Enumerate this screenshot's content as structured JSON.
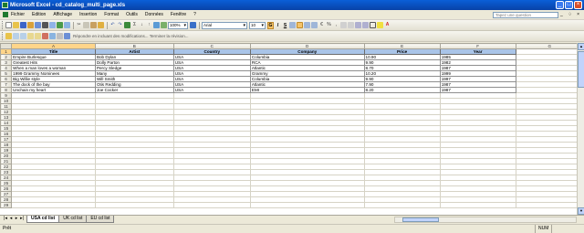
{
  "window": {
    "title": "Microsoft Excel - cd_catalog_multi_page.xls",
    "controls": [
      "_",
      "□",
      "×"
    ]
  },
  "menu": {
    "items": [
      "Fichier",
      "Edition",
      "Affichage",
      "Insertion",
      "Format",
      "Outils",
      "Données",
      "Fenêtre",
      "?"
    ],
    "help_placeholder": "Tapez une question",
    "doc_controls": "_ ♢ ×"
  },
  "toolbar": {
    "zoom": "100%",
    "font_name": "Arial",
    "font_size": "10",
    "bold": "G",
    "italic": "I",
    "underline": "S",
    "review_text": "Répondre en incluant des modifications... Terminer la révision..."
  },
  "formula_bar": {
    "name_box": "",
    "fx": "fx",
    "content": ""
  },
  "grid": {
    "columns": [
      "A",
      "B",
      "C",
      "D",
      "E",
      "F",
      "G"
    ],
    "header_row": [
      "Title",
      "Artist",
      "Country",
      "Company",
      "Price",
      "Year"
    ],
    "rows": [
      [
        "Empire Burlesque",
        "Bob Dylan",
        "USA",
        "Columbia",
        "10.90",
        "1985"
      ],
      [
        "Greatest Hits",
        "Dolly Parton",
        "USA",
        "RCA",
        "9.90",
        "1982"
      ],
      [
        "When a man loves a woman",
        "Percy Sledge",
        "USA",
        "Atlantic",
        "8.70",
        "1987"
      ],
      [
        "1999 Grammy Nominees",
        "Many",
        "USA",
        "Grammy",
        "10.20",
        "1999"
      ],
      [
        "Big Willie style",
        "Will Smith",
        "USA",
        "Columbia",
        "9.90",
        "1997"
      ],
      [
        "The dock of the bay",
        "Otis Redding",
        "USA",
        "Atlantic",
        "7.90",
        "1987"
      ],
      [
        "Unchain my heart",
        "Joe Cocker",
        "USA",
        "EMI",
        "8.20",
        "1987"
      ]
    ],
    "row_numbers": [
      "1",
      "2",
      "3",
      "4",
      "5",
      "6",
      "7",
      "8",
      "9",
      "10",
      "11",
      "12",
      "13",
      "14",
      "15",
      "16",
      "17",
      "18",
      "19",
      "20",
      "21",
      "22",
      "23",
      "24",
      "25",
      "26",
      "27",
      "28",
      "29"
    ]
  },
  "sheets": {
    "tabs": [
      "USA cd list",
      "UK cd list",
      "EU cd list"
    ],
    "active": "USA cd list",
    "nav": [
      "|◂",
      "◂",
      "▸",
      "▸|"
    ]
  },
  "status": {
    "left": "Prêt",
    "num": "NUM"
  }
}
